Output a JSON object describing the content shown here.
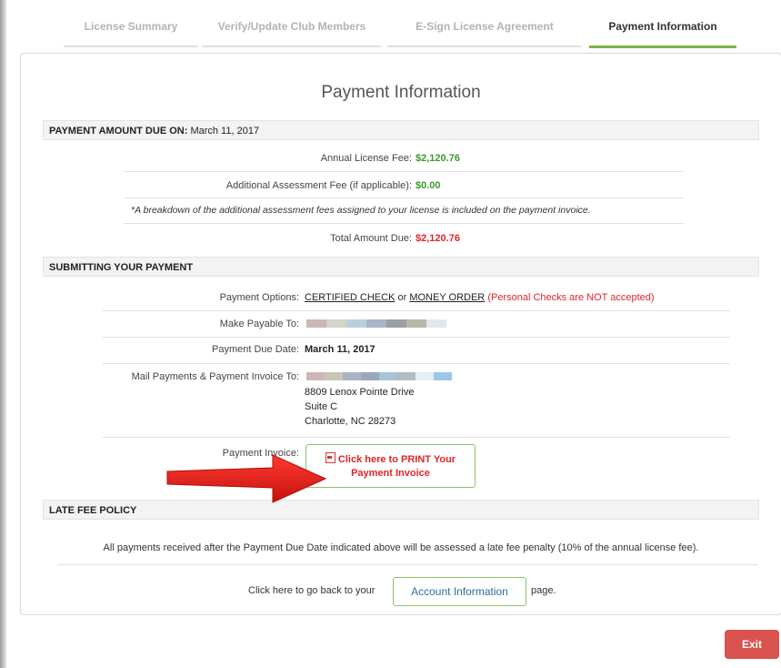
{
  "tabs": [
    {
      "label": "License Summary"
    },
    {
      "label": "Verify/Update Club Members"
    },
    {
      "label": "E-Sign License Agreement"
    },
    {
      "label": "Payment Information"
    }
  ],
  "page_title": "Payment Information",
  "amount_section": {
    "header_label": "PAYMENT AMOUNT DUE ON:",
    "header_date": "March 11, 2017",
    "annual_fee_label": "Annual License Fee:",
    "annual_fee_value": "$2,120.76",
    "additional_fee_label": "Additional Assessment Fee (if applicable):",
    "additional_fee_value": "$0.00",
    "note": "*A breakdown of the additional assessment fees assigned to your license is included on the payment invoice.",
    "total_label": "Total Amount Due:",
    "total_value": "$2,120.76"
  },
  "submit_section": {
    "header": "SUBMITTING YOUR PAYMENT",
    "options_label": "Payment Options:",
    "option_1": "CERTIFIED CHECK",
    "or_text": "or",
    "option_2": "MONEY ORDER",
    "options_note": "(Personal Checks are NOT accepted)",
    "payable_label": "Make Payable To:",
    "due_date_label": "Payment Due Date:",
    "due_date_value": "March 11, 2017",
    "mail_label": "Mail Payments & Payment Invoice To:",
    "address_line_1": "8809 Lenox Pointe Drive",
    "address_line_2": "Suite C",
    "address_line_3": "Charlotte, NC 28273",
    "invoice_label": "Payment Invoice:",
    "print_button_line_1": "Click here to PRINT Your",
    "print_button_line_2": "Payment Invoice"
  },
  "late_fee_section": {
    "header": "LATE FEE POLICY",
    "text": "All payments received after the Payment Due Date indicated above will be assessed a late fee penalty (10% of the annual license fee)."
  },
  "back_link": {
    "prefix": "Click here to go back to your",
    "button_label": "Account Information",
    "suffix": "page."
  },
  "exit_button": "Exit",
  "colors": {
    "accent_green": "#7cb342",
    "money_green": "#3a9a2a",
    "alert_red": "#e0242a",
    "exit_red": "#d9534f",
    "arrow_red": "#e8211d"
  }
}
